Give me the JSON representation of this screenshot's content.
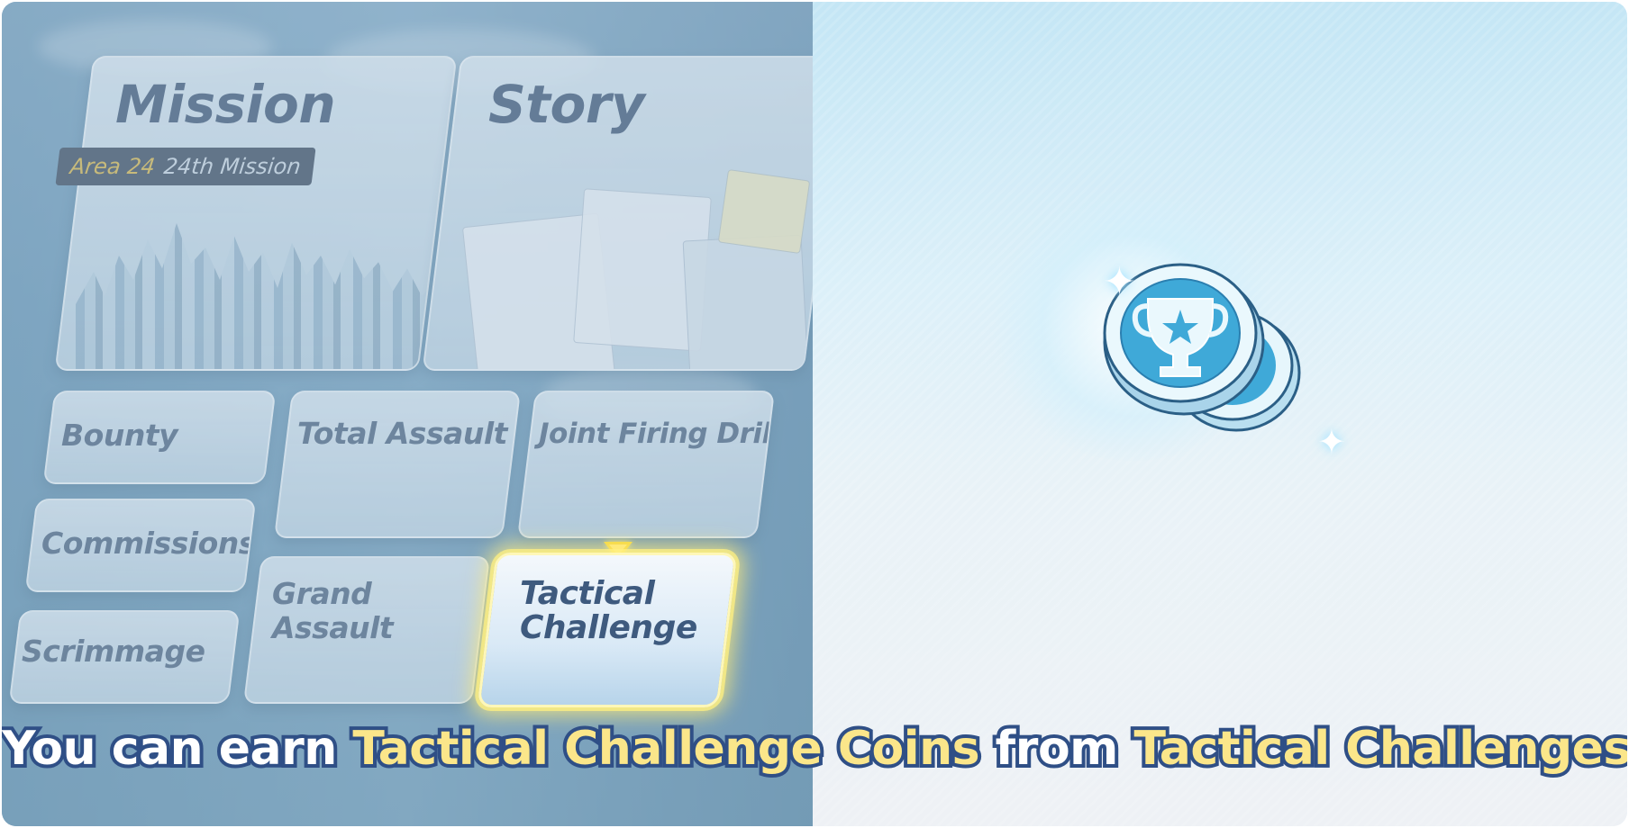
{
  "menu": {
    "mission": {
      "title": "Mission",
      "badge_area": "Area 24",
      "badge_name": "24th Mission"
    },
    "story": {
      "title": "Story"
    },
    "bounty": {
      "title": "Bounty"
    },
    "total_assault": {
      "title": "Total Assault"
    },
    "joint_firing_drill": {
      "title": "Joint Firing Drill"
    },
    "commissions": {
      "title": "Commissions"
    },
    "grand_assault": {
      "title_line1": "Grand",
      "title_line2": "Assault"
    },
    "scrimmage": {
      "title": "Scrimmage"
    },
    "tactical_challenge": {
      "title_line1": "Tactical",
      "title_line2": "Challenge"
    }
  },
  "caption": {
    "part1": "You can earn ",
    "part2": "Tactical Challenge Coins",
    "part3": " from ",
    "part4": "Tactical Challenges."
  },
  "icons": {
    "item": "tactical-challenge-coin-icon",
    "highlight": "yellow-arrow-marker"
  },
  "colors": {
    "caption_white": "#ffffff",
    "caption_yellow": "#fbe68a",
    "caption_outline": "#2f4f86",
    "highlight_glow": "#fff07a",
    "coin_blue": "#3fa9d8"
  }
}
